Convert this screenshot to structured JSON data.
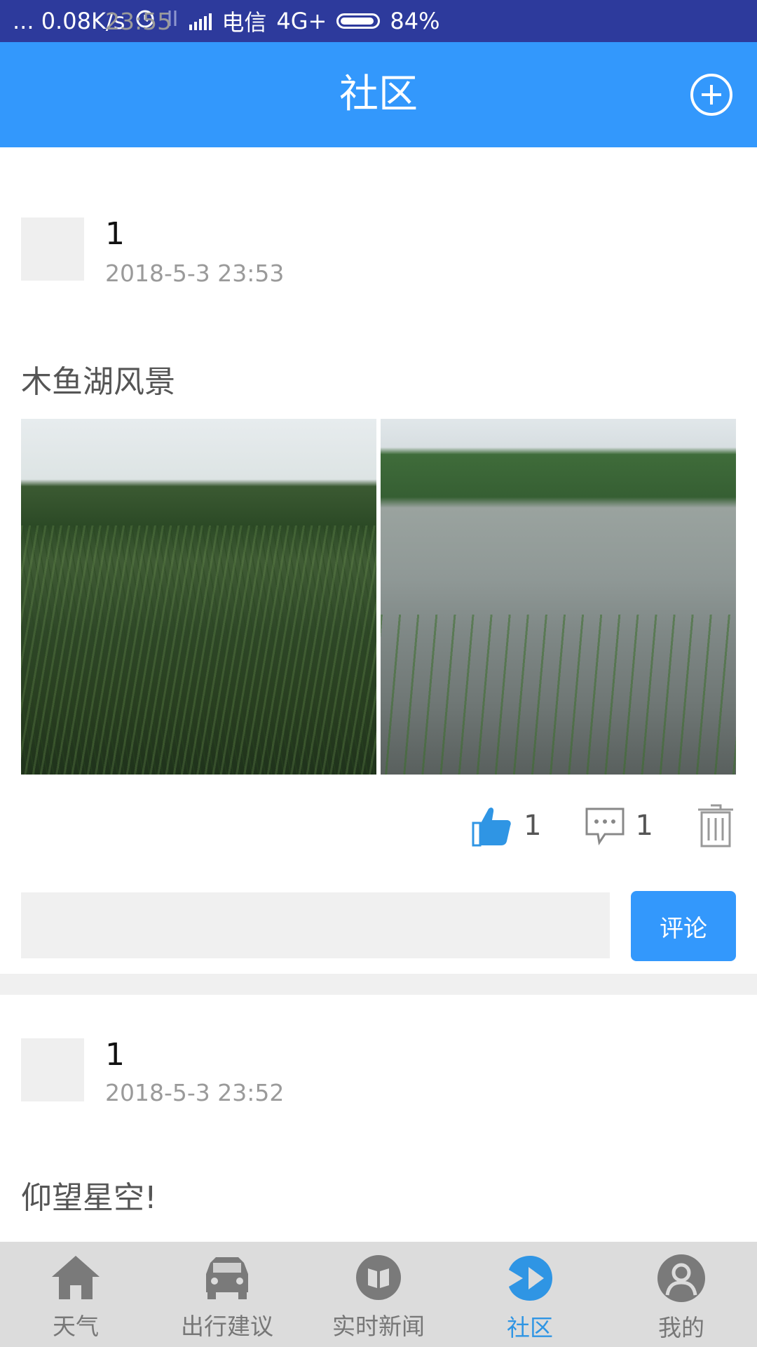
{
  "status_bar": {
    "time": "23:55",
    "network_speed": "... 0.08K/s",
    "carrier": "电信",
    "network_type": "4G+",
    "battery": "84%",
    "battery_level": 0.84
  },
  "app_bar": {
    "title": "社区",
    "add_icon": "plus-circle-icon"
  },
  "posts": [
    {
      "username": "1",
      "time": "2018-5-3 23:53",
      "text": "木鱼湖风景",
      "likes": "1",
      "comments": "1",
      "comment_placeholder": "",
      "comment_button": "评论"
    },
    {
      "username": "1",
      "time": "2018-5-3 23:52",
      "text": "仰望星空!"
    }
  ],
  "tabs": [
    {
      "label": "天气",
      "icon": "home-icon"
    },
    {
      "label": "出行建议",
      "icon": "car-icon"
    },
    {
      "label": "实时新闻",
      "icon": "book-icon"
    },
    {
      "label": "社区",
      "icon": "community-icon",
      "active": true
    },
    {
      "label": "我的",
      "icon": "user-icon"
    }
  ],
  "colors": {
    "status_bar": "#2d3a9c",
    "app_bar": "#3398fc",
    "accent": "#3398fc",
    "tab_active": "#2f95e4",
    "tab_inactive": "#777777",
    "tab_bar_bg": "#dcdcdc"
  }
}
